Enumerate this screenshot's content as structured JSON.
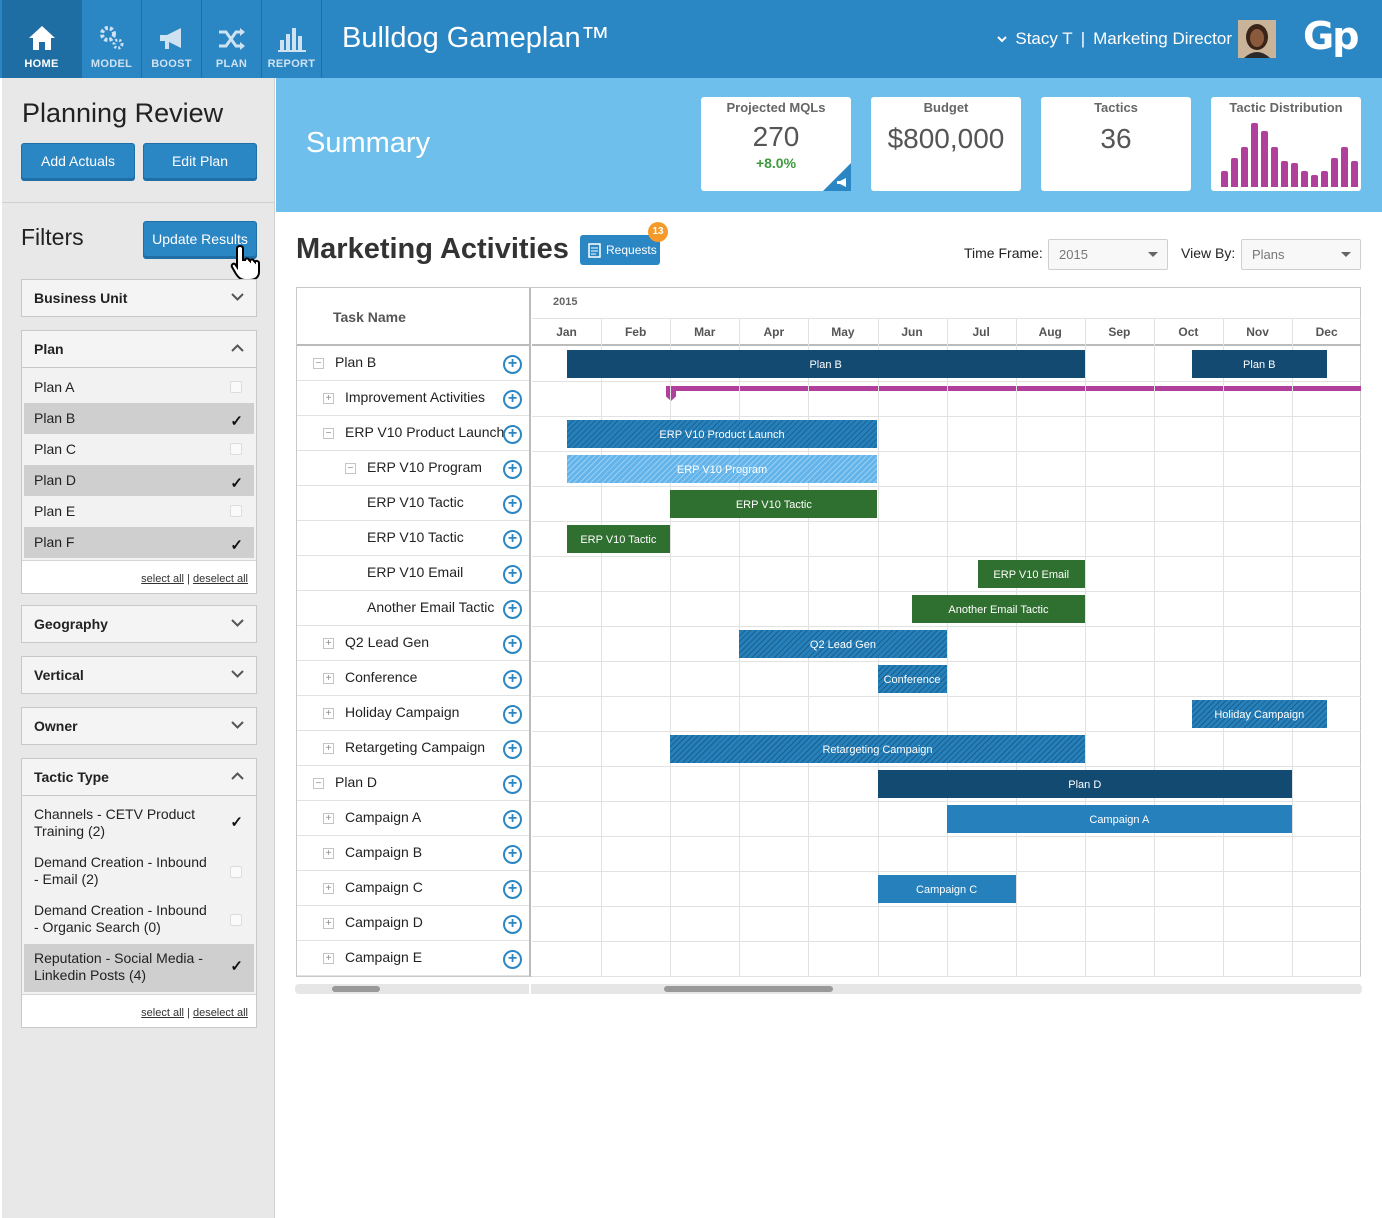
{
  "nav": {
    "items": [
      {
        "label": "HOME",
        "icon": "home-icon"
      },
      {
        "label": "MODEL",
        "icon": "gears-icon"
      },
      {
        "label": "BOOST",
        "icon": "megaphone-icon"
      },
      {
        "label": "PLAN",
        "icon": "shuffle-icon"
      },
      {
        "label": "REPORT",
        "icon": "bar-chart-icon"
      }
    ],
    "app_title": "Bulldog Gameplan™",
    "user_name": "Stacy T",
    "user_sep": "|",
    "user_role": "Marketing Director",
    "logo": "Gp"
  },
  "sidebar": {
    "title": "Planning Review",
    "add_actuals": "Add Actuals",
    "edit_plan": "Edit Plan",
    "filters_title": "Filters",
    "update_results": "Update Results",
    "groups": {
      "business_unit": "Business Unit",
      "plan": "Plan",
      "geography": "Geography",
      "vertical": "Vertical",
      "owner": "Owner",
      "tactic_type": "Tactic Type"
    },
    "plans": [
      {
        "label": "Plan A",
        "checked": false
      },
      {
        "label": "Plan B",
        "checked": true
      },
      {
        "label": "Plan C",
        "checked": false
      },
      {
        "label": "Plan D",
        "checked": true
      },
      {
        "label": "Plan E",
        "checked": false
      },
      {
        "label": "Plan F",
        "checked": true
      }
    ],
    "tactic_types": [
      {
        "label": "Channels - CETV Product Training (2)",
        "checked": true
      },
      {
        "label": "Demand Creation - Inbound - Email (2)",
        "checked": false
      },
      {
        "label": "Demand Creation - Inbound - Organic Search (0)",
        "checked": false
      },
      {
        "label": "Reputation - Social Media - Linkedin Posts (4)",
        "checked": true
      }
    ],
    "select_all": "select all",
    "deselect_all": "deselect all",
    "pipe": "|",
    "check_mark": "✓"
  },
  "summary": {
    "title": "Summary",
    "cards": {
      "mqls_label": "Projected MQLs",
      "mqls_value": "270",
      "mqls_delta": "+8.0%",
      "budget_label": "Budget",
      "budget_value": "$800,000",
      "tactics_label": "Tactics",
      "tactics_value": "36",
      "distribution_label": "Tactic Distribution"
    },
    "distribution_levels": [
      0.25,
      0.45,
      0.62,
      1.0,
      0.88,
      0.62,
      0.4,
      0.38,
      0.25,
      0.18,
      0.25,
      0.45,
      0.62,
      0.4
    ]
  },
  "activities": {
    "title": "Marketing Activities",
    "requests_label": "Requests",
    "requests_count": "13",
    "time_frame_label": "Time Frame:",
    "time_frame_value": "2015",
    "view_by_label": "View By:",
    "view_by_value": "Plans",
    "task_name_header": "Task Name",
    "year": "2015",
    "months": [
      "Jan",
      "Feb",
      "Mar",
      "Apr",
      "May",
      "Jun",
      "Jul",
      "Aug",
      "Sep",
      "Oct",
      "Nov",
      "Dec"
    ],
    "rows": [
      {
        "name": "Plan B",
        "level": 0,
        "toggle": "−"
      },
      {
        "name": "Improvement Activities",
        "level": 1,
        "toggle": "+"
      },
      {
        "name": "ERP V10 Product Launch",
        "level": 1,
        "toggle": "−"
      },
      {
        "name": "ERP V10 Program",
        "level": 2,
        "toggle": "−"
      },
      {
        "name": "ERP V10 Tactic",
        "level": 3,
        "toggle": ""
      },
      {
        "name": "ERP V10 Tactic",
        "level": 3,
        "toggle": ""
      },
      {
        "name": "ERP V10 Email",
        "level": 3,
        "toggle": ""
      },
      {
        "name": "Another Email Tactic",
        "level": 3,
        "toggle": ""
      },
      {
        "name": "Q2 Lead Gen",
        "level": 1,
        "toggle": "+"
      },
      {
        "name": "Conference",
        "level": 1,
        "toggle": "+"
      },
      {
        "name": "Holiday Campaign",
        "level": 1,
        "toggle": "+"
      },
      {
        "name": "Retargeting Campaign",
        "level": 1,
        "toggle": "+"
      },
      {
        "name": "Plan D",
        "level": 0,
        "toggle": "−"
      },
      {
        "name": "Campaign A",
        "level": 1,
        "toggle": "+"
      },
      {
        "name": "Campaign B",
        "level": 1,
        "toggle": "+"
      },
      {
        "name": "Campaign C",
        "level": 1,
        "toggle": "+"
      },
      {
        "name": "Campaign D",
        "level": 1,
        "toggle": "+"
      },
      {
        "name": "Campaign E",
        "level": 1,
        "toggle": "+"
      }
    ],
    "bars": [
      {
        "row": 0,
        "start": 0.5,
        "end": 8.0,
        "label": "Plan B",
        "style": "navy"
      },
      {
        "row": 0,
        "start": 9.55,
        "end": 11.5,
        "label": "Plan B",
        "style": "navy"
      },
      {
        "row": 2,
        "start": 0.5,
        "end": 5.0,
        "label": "ERP V10 Product Launch",
        "style": "hatch"
      },
      {
        "row": 3,
        "start": 0.5,
        "end": 5.0,
        "label": "ERP V10 Program",
        "style": "lighthatch"
      },
      {
        "row": 4,
        "start": 2.0,
        "end": 5.0,
        "label": "ERP V10 Tactic",
        "style": "green"
      },
      {
        "row": 5,
        "start": 0.5,
        "end": 2.0,
        "label": "ERP V10 Tactic",
        "style": "green"
      },
      {
        "row": 6,
        "start": 6.45,
        "end": 8.0,
        "label": "ERP V10 Email",
        "style": "green"
      },
      {
        "row": 7,
        "start": 5.5,
        "end": 8.0,
        "label": "Another Email Tactic",
        "style": "green"
      },
      {
        "row": 8,
        "start": 3.0,
        "end": 6.0,
        "label": "Q2 Lead Gen",
        "style": "dhatch"
      },
      {
        "row": 9,
        "start": 5.0,
        "end": 6.0,
        "label": "Conference",
        "style": "dhatch"
      },
      {
        "row": 10,
        "start": 9.55,
        "end": 11.5,
        "label": "Holiday Campaign",
        "style": "dhatch"
      },
      {
        "row": 11,
        "start": 2.0,
        "end": 8.0,
        "label": "Retargeting Campaign",
        "style": "dhatch"
      },
      {
        "row": 12,
        "start": 5.0,
        "end": 11.0,
        "label": "Plan D",
        "style": "navy"
      },
      {
        "row": 13,
        "start": 6.0,
        "end": 11.0,
        "label": "Campaign A",
        "style": "blue"
      },
      {
        "row": 15,
        "start": 5.0,
        "end": 7.0,
        "label": "Campaign C",
        "style": "blue"
      }
    ]
  },
  "colors": {
    "nav_blue": "#2b86c4",
    "summary_band": "#6fbfec",
    "plan_bar": "#134a72",
    "tactic_green": "#2f6f2f",
    "distribution_magenta": "#b0409c",
    "positive_delta": "#3e9a3e",
    "badge_orange": "#f59a2a"
  }
}
